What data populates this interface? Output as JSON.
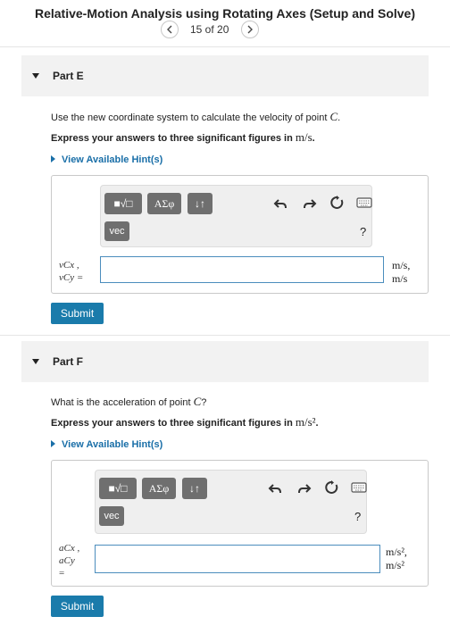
{
  "header": {
    "title": "Relative-Motion Analysis using Rotating Axes (Setup and Solve)",
    "pager_text": "15 of 20"
  },
  "partE": {
    "label": "Part E",
    "question_pre": "Use the new coordinate system to calculate the velocity of point ",
    "question_var": "C",
    "question_post": ".",
    "instruction_pre": "Express your answers to three significant figures in ",
    "instruction_unit": "m/s",
    "instruction_post": ".",
    "hint": "View Available Hint(s)",
    "toolbar": {
      "templates": "■√□",
      "greek": "ΑΣφ",
      "sort": "↓↑",
      "vec": "vec",
      "help": "?"
    },
    "variable_line1": "vCx ,",
    "variable_line2": "vCy =",
    "unit_line1": "m/s,",
    "unit_line2": "m/s",
    "submit": "Submit"
  },
  "partF": {
    "label": "Part F",
    "question_pre": "What is the acceleration of point ",
    "question_var": "C",
    "question_post": "?",
    "instruction_pre": "Express your answers to three significant figures in ",
    "instruction_unit": "m/s²",
    "instruction_post": ".",
    "hint": "View Available Hint(s)",
    "toolbar": {
      "templates": "■√□",
      "greek": "ΑΣφ",
      "sort": "↓↑",
      "vec": "vec",
      "help": "?"
    },
    "variable_line1": "aCx ,",
    "variable_line2": "aCy",
    "variable_line3": "=",
    "unit_line1": "m/s²,",
    "unit_line2": "m/s²",
    "submit": "Submit"
  }
}
